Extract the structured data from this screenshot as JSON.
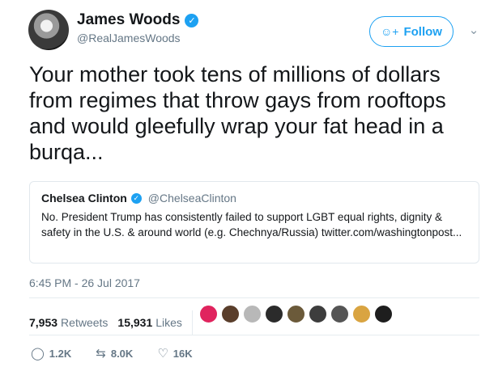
{
  "author": {
    "display_name": "James Woods",
    "handle": "@RealJamesWoods",
    "verified_icon": "verified-badge-icon"
  },
  "follow_button": {
    "label": "Follow",
    "icon": "add-user-icon"
  },
  "caret_icon": "chevron-down-icon",
  "tweet_text": "Your mother took tens of millions of dollars from regimes that throw gays from rooftops and would gleefully wrap your fat head in a burqa...",
  "quoted_tweet": {
    "display_name": "Chelsea Clinton",
    "handle": "@ChelseaClinton",
    "text": "No. President Trump has consistently failed to support LGBT equal rights, dignity & safety in the U.S. & around world (e.g. Chechnya/Russia) twitter.com/washingtonpost..."
  },
  "timestamp": "6:45 PM - 26 Jul 2017",
  "stats": {
    "retweets_count": "7,953",
    "retweets_label": "Retweets",
    "likes_count": "15,931",
    "likes_label": "Likes"
  },
  "likers": [
    {
      "name": "liker-avatar-1",
      "color": "#e0245e"
    },
    {
      "name": "liker-avatar-2",
      "color": "#5a3e2b"
    },
    {
      "name": "liker-avatar-3",
      "color": "#b8b8b8"
    },
    {
      "name": "liker-avatar-4",
      "color": "#2b2b2b"
    },
    {
      "name": "liker-avatar-5",
      "color": "#6b5a3a"
    },
    {
      "name": "liker-avatar-6",
      "color": "#3d3d3d"
    },
    {
      "name": "liker-avatar-7",
      "color": "#555555"
    },
    {
      "name": "liker-avatar-8",
      "color": "#d9a441"
    },
    {
      "name": "liker-avatar-9",
      "color": "#1e1e1e"
    }
  ],
  "actions": {
    "reply_count": "1.2K",
    "retweet_count": "8.0K",
    "like_count": "16K"
  },
  "colors": {
    "accent": "#1da1f2",
    "secondary_text": "#657786",
    "primary_text": "#14171a",
    "border": "#e1e8ed"
  }
}
